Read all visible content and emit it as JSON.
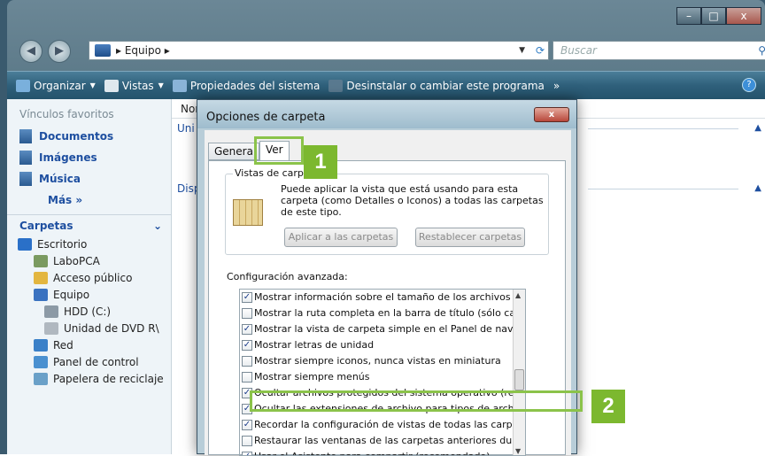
{
  "window": {
    "controls": [
      "–",
      "□",
      "x"
    ]
  },
  "address": {
    "path": "▸ Equipo ▸",
    "search_placeholder": "Buscar"
  },
  "toolbar": {
    "organize": "Organizar",
    "views": "Vistas",
    "properties": "Propiedades del sistema",
    "uninstall": "Desinstalar o cambiar este programa",
    "more": "»",
    "help": "?"
  },
  "sidebar": {
    "favorites_title": "Vínculos favoritos",
    "favorites": [
      "Documentos",
      "Imágenes",
      "Música"
    ],
    "more": "Más »",
    "folders_title": "Carpetas",
    "tree": [
      {
        "label": "Escritorio",
        "indent": 1,
        "color": "#2a70c8"
      },
      {
        "label": "LaboPCA",
        "indent": 2,
        "color": "#7a9a60"
      },
      {
        "label": "Acceso público",
        "indent": 2,
        "color": "#e3b640"
      },
      {
        "label": "Equipo",
        "indent": 2,
        "color": "#3a72c0"
      },
      {
        "label": "HDD (C:)",
        "indent": 3,
        "color": "#8c9aa6"
      },
      {
        "label": "Unidad de DVD R\\",
        "indent": 3,
        "color": "#b0b8c0"
      },
      {
        "label": "Red",
        "indent": 2,
        "color": "#3a80c8"
      },
      {
        "label": "Panel de control",
        "indent": 2,
        "color": "#4a90d0"
      },
      {
        "label": "Papelera de reciclaje",
        "indent": 2,
        "color": "#6aa0c8"
      }
    ]
  },
  "main": {
    "column": "Nom",
    "group1": "Uni",
    "group2": "Disp"
  },
  "dialog": {
    "title": "Opciones de carpeta",
    "close": "x",
    "tabs": [
      "Genera",
      "Ver"
    ],
    "group_legend": "Vistas de carpeta",
    "group_text": "Puede aplicar la vista que está usando para esta carpeta (como Detalles o Iconos) a todas las carpetas de este tipo.",
    "apply_button": "Aplicar a las carpetas",
    "reset_button": "Restablecer carpetas",
    "advanced_label": "Configuración avanzada:",
    "options": [
      {
        "label": "Mostrar información sobre el tamaño de los archivos en su",
        "checked": true
      },
      {
        "label": "Mostrar la ruta completa en la barra de título (sólo carpeta",
        "checked": false
      },
      {
        "label": "Mostrar la vista de carpeta simple en el Panel de navegac",
        "checked": true
      },
      {
        "label": "Mostrar letras de unidad",
        "checked": true
      },
      {
        "label": "Mostrar siempre iconos, nunca vistas en miniatura",
        "checked": false
      },
      {
        "label": "Mostrar siempre menús",
        "checked": false
      },
      {
        "label": "Ocultar archivos protegidos del sistema operativo (recome",
        "checked": true
      },
      {
        "label": "Ocultar las extensiones de archivo para tipos de archivo conocidos",
        "checked": true
      },
      {
        "label": "Recordar la configuración de vistas de todas las carpetas",
        "checked": true
      },
      {
        "label": "Restaurar las ventanas de las carpetas anteriores durante",
        "checked": false
      },
      {
        "label": "Usar el Asistente para compartir (recomendado)",
        "checked": true
      }
    ]
  },
  "callouts": {
    "one": "1",
    "two": "2"
  },
  "colors": {
    "accent_green": "#7cb82f",
    "toolbar": "#2f607b"
  }
}
